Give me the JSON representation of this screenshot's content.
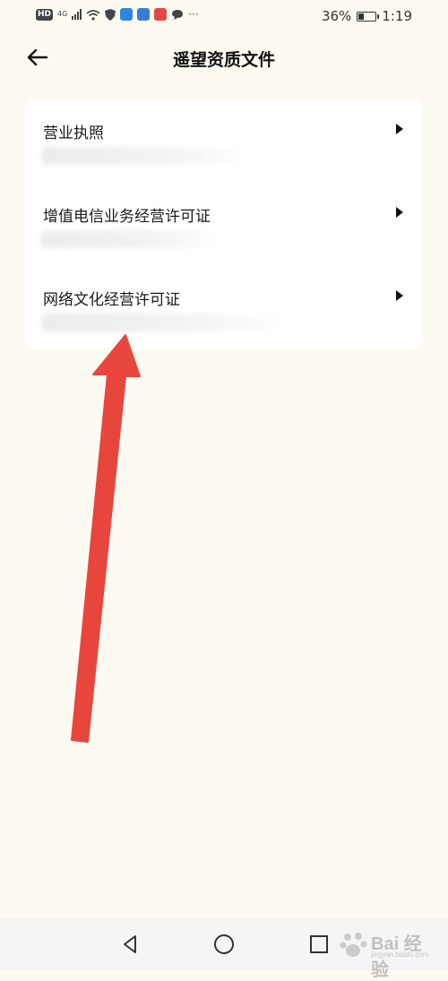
{
  "status_bar": {
    "hd": "HD",
    "network": "4G",
    "overflow": "···",
    "battery_percent": "36%",
    "battery_level": 0.36,
    "time": "1:19"
  },
  "header": {
    "title": "遥望资质文件",
    "back_icon": "arrow-left-icon"
  },
  "documents": {
    "items": [
      {
        "label": "营业执照",
        "arrow_icon": "triangle-right-icon"
      },
      {
        "label": "增值电信业务经营许可证",
        "arrow_icon": "triangle-right-icon"
      },
      {
        "label": "网络文化经营许可证",
        "arrow_icon": "triangle-right-icon"
      }
    ]
  },
  "annotation": {
    "color": "#e8463c"
  },
  "nav_bar": {
    "back_icon": "triangle-back-icon",
    "home_icon": "circle-home-icon",
    "recents_icon": "square-recents-icon"
  },
  "watermark": {
    "brand": "Bai 经验",
    "sub": "jingyan.baidu.com"
  }
}
